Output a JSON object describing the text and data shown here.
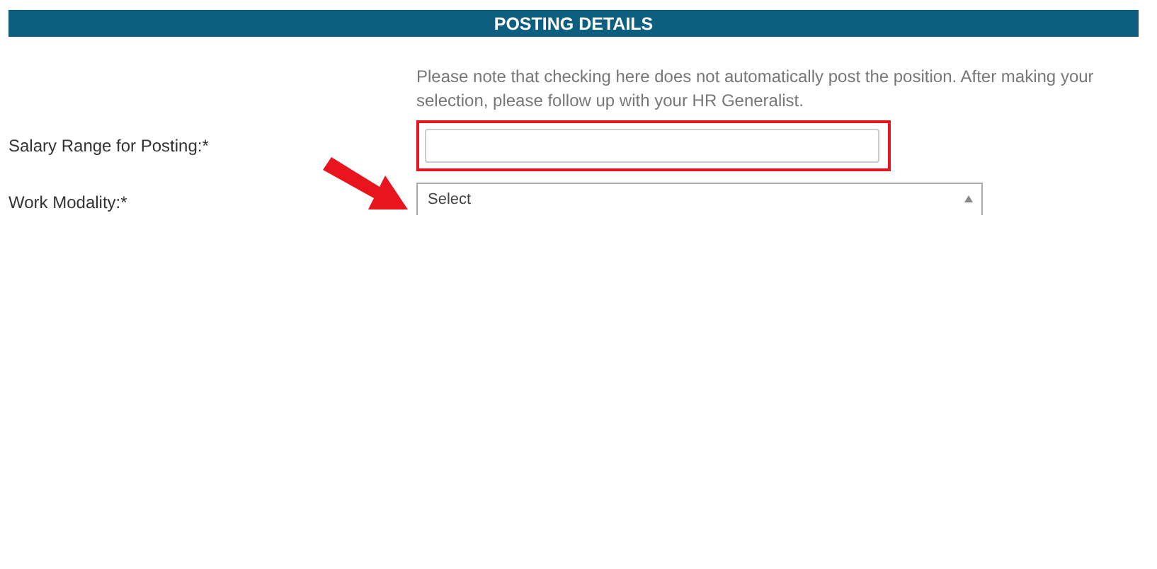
{
  "section_header": "POSTING DETAILS",
  "note": "Please note that checking here does not automatically post the position. After making your selection, please follow up with your HR Generalist.",
  "fields": [
    {
      "kind": "text",
      "label": "Salary Range for Posting:*",
      "highlighted": true
    },
    {
      "kind": "select",
      "label": "Work Modality:*",
      "value": "Select",
      "highlighted": false
    }
  ]
}
